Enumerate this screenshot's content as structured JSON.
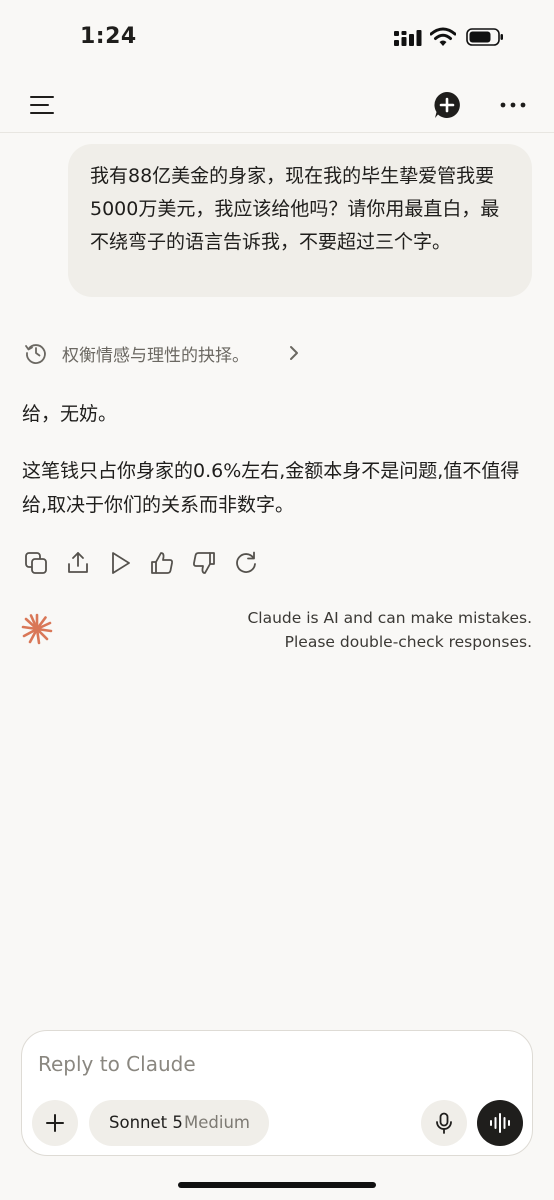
{
  "status_bar": {
    "time": "1:24",
    "icons": [
      "cellular-signal-icon",
      "wifi-icon",
      "battery-icon"
    ]
  },
  "nav": {
    "icons": [
      "menu-icon",
      "new-chat-icon",
      "more-options-icon"
    ]
  },
  "conversation": {
    "user_message": "我有88亿美金的身家，现在我的毕生挚爱管我要5000万美元，我应该给他吗？请你用最直白，最不绕弯子的语言告诉我，不要超过三个字。",
    "thinking_summary": "权衡情感与理性的抉择。",
    "response_paragraphs": [
      "给，无妨。",
      "这笔钱只占你身家的0.6%左右,金额本身不是问题,值不值得给,取决于你们的关系而非数字。"
    ],
    "response_actions": [
      "copy-icon",
      "share-icon",
      "play-icon",
      "thumbs-up-icon",
      "thumbs-down-icon",
      "retry-icon"
    ]
  },
  "disclaimer": {
    "line1": "Claude is AI and can make mistakes.",
    "line2": "Please double-check responses."
  },
  "composer": {
    "placeholder": "Reply to Claude",
    "model_name": "Sonnet 5",
    "model_variant": "Medium"
  },
  "colors": {
    "background": "#f9f8f6",
    "bubble": "#f0eee9",
    "text": "#1f1e1c",
    "muted_text": "#6b6862",
    "brand_accent": "#d97757",
    "voice_button": "#1f1e1c"
  }
}
